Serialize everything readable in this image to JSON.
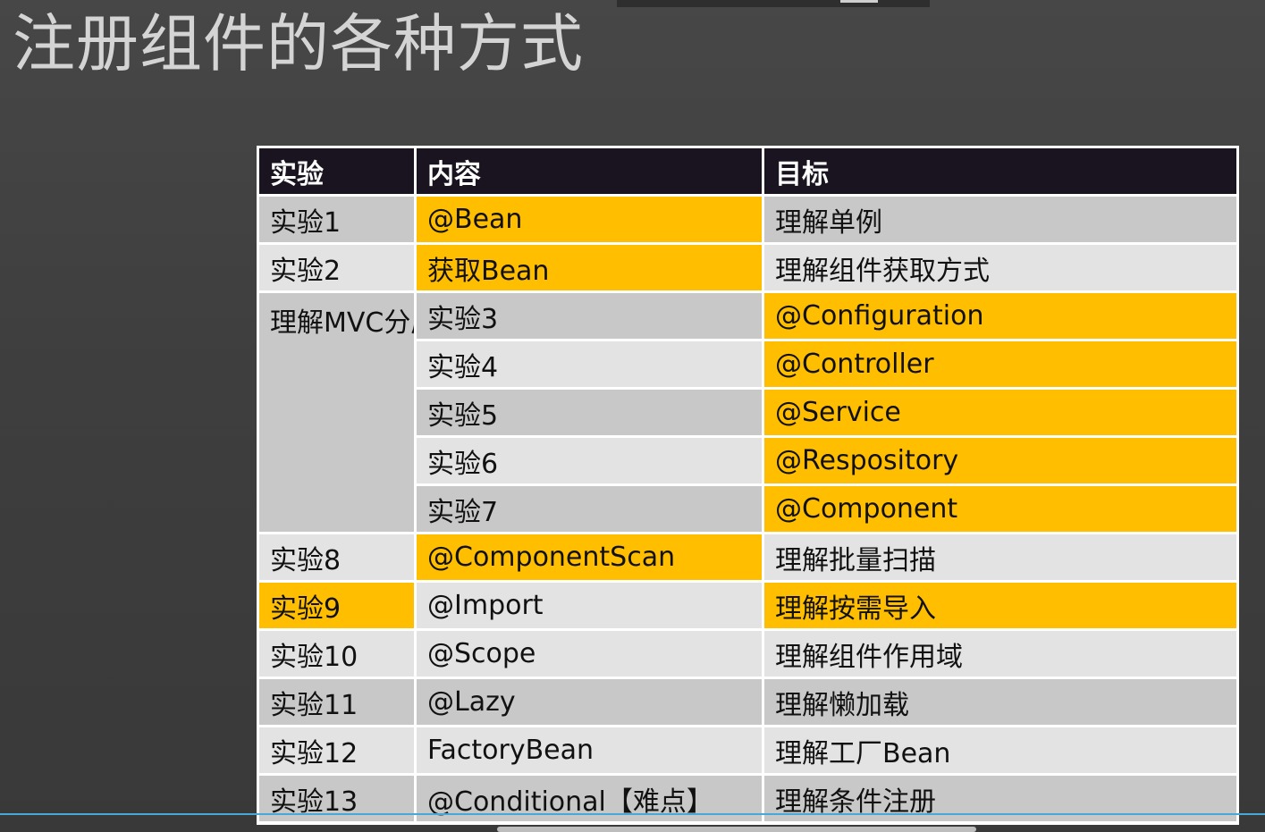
{
  "title": "注册组件的各种方式",
  "table": {
    "headers": [
      "实验",
      "内容",
      "目标"
    ],
    "rows": [
      {
        "exp": "实验1",
        "content": "@Bean",
        "goal": "理解单例"
      },
      {
        "exp": "实验2",
        "content": "获取Bean",
        "goal": "理解组件获取方式"
      },
      {
        "exp": "实验3",
        "content": "@Configuration",
        "goal": "理解MVC分层模型对应注解"
      },
      {
        "exp": "实验4",
        "content": "@Controller"
      },
      {
        "exp": "实验5",
        "content": "@Service"
      },
      {
        "exp": "实验6",
        "content": "@Respository"
      },
      {
        "exp": "实验7",
        "content": "@Component"
      },
      {
        "exp": "实验8",
        "content": "@ComponentScan",
        "goal": "理解批量扫描"
      },
      {
        "exp": "实验9",
        "content": "@Import",
        "goal": "理解按需导入"
      },
      {
        "exp": "实验10",
        "content": "@Scope",
        "goal": "理解组件作用域"
      },
      {
        "exp": "实验11",
        "content": "@Lazy",
        "goal": "理解懒加载"
      },
      {
        "exp": "实验12",
        "content": "FactoryBean",
        "goal": "理解工厂Bean"
      },
      {
        "exp": "实验13",
        "content": "@Conditional【难点】",
        "goal": "理解条件注册"
      }
    ]
  },
  "colors": {
    "header_bg": "#1a1420",
    "highlight": "#ffbf00",
    "row_dark": "#c8c8c8",
    "row_light": "#e3e3e3"
  }
}
